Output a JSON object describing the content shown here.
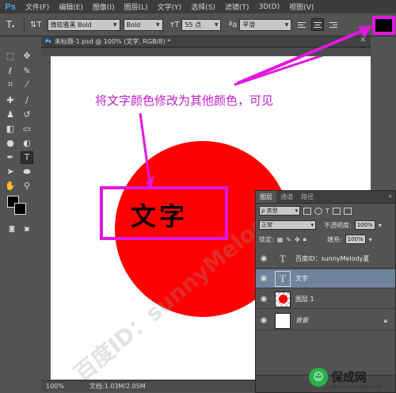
{
  "menubar": {
    "app_logo": "Ps",
    "items": [
      "文件(F)",
      "编辑(E)",
      "图像(I)",
      "图层(L)",
      "文字(Y)",
      "选择(S)",
      "滤镜(T)",
      "3D(D)",
      "视图(V)"
    ]
  },
  "options_bar": {
    "font_family": "微软雅黑 Bold",
    "font_style": "Bold",
    "font_size": "55 点",
    "aa_label": "ªa",
    "antialias": "平滑",
    "text_color": "#000000"
  },
  "document": {
    "tab_title": "未标题-1.psd @ 100% (文字, RGB/8) *",
    "zoom": "100%",
    "doc_info": "文档:1.03M/2.05M",
    "annotation": "将文字颜色修改为其他颜色，可见",
    "layer_text": "文字",
    "watermark": "百度ID：sunnyMelody夏"
  },
  "layers_panel": {
    "tabs": [
      "图层",
      "通道",
      "路径"
    ],
    "filter_label": "ρ 类型",
    "blend_mode": "正常",
    "opacity_label": "不透明度:",
    "opacity_value": "100%",
    "lock_label": "锁定:",
    "fill_label": "填充:",
    "fill_value": "100%",
    "layers": [
      {
        "name": "百度ID：sunnyMelody夏",
        "kind": "text"
      },
      {
        "name": "文字",
        "kind": "text",
        "selected": true
      },
      {
        "name": "图层 1",
        "kind": "pixel"
      },
      {
        "name": "背景",
        "kind": "background"
      }
    ]
  },
  "site_logo": {
    "name": "保成网",
    "url": "zsbaochengw.com"
  },
  "colors": {
    "accent_annotation": "#e018e0",
    "circle": "#ff0000",
    "selected_layer": "#6f839c"
  }
}
